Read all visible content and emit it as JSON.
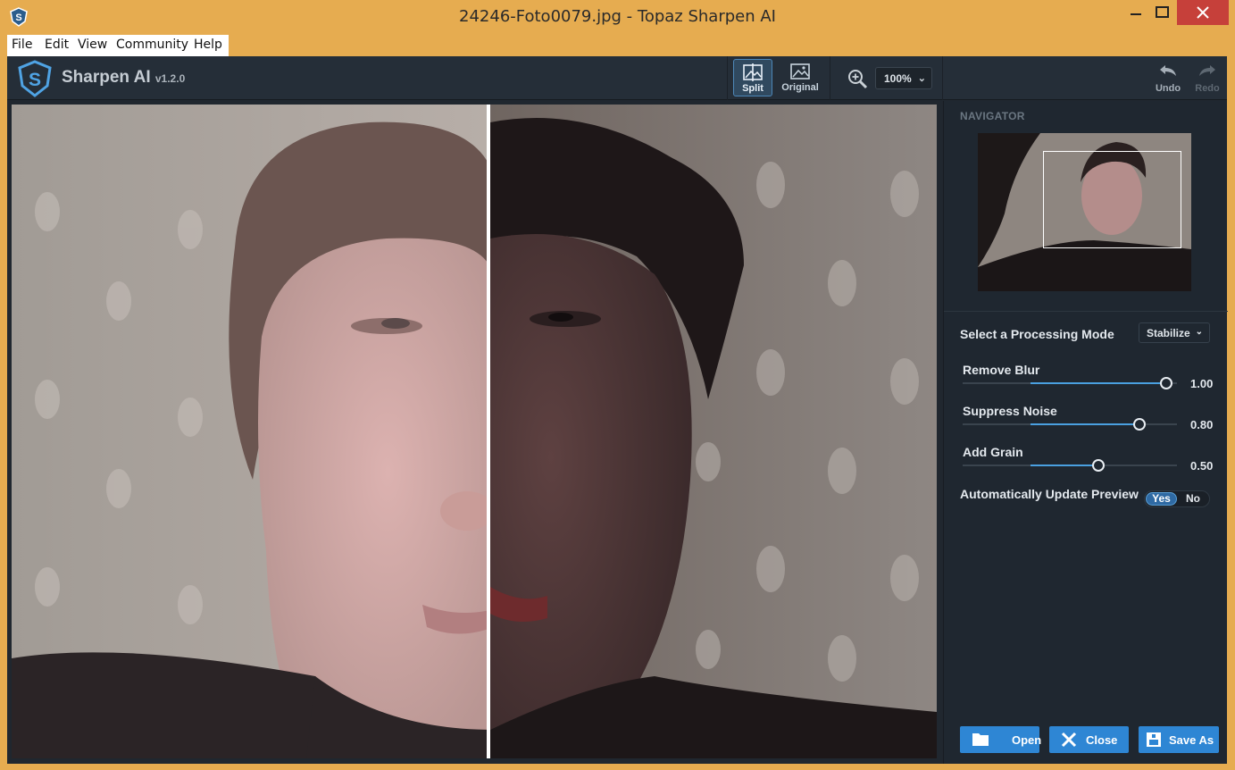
{
  "window": {
    "title": "24246-Foto0079.jpg - Topaz Sharpen AI"
  },
  "menu": {
    "items": [
      "File",
      "Edit",
      "View",
      "Community",
      "Help"
    ]
  },
  "app": {
    "brand": "Sharpen AI",
    "version": "v1.2.0"
  },
  "toolbar": {
    "split_label": "Split",
    "original_label": "Original",
    "zoom_value": "100%",
    "undo_label": "Undo",
    "redo_label": "Redo"
  },
  "navigator": {
    "title": "NAVIGATOR"
  },
  "settings": {
    "mode_label": "Select a Processing Mode",
    "mode_value": "Stabilize",
    "sliders": [
      {
        "label": "Remove Blur",
        "value": 1.0,
        "display": "1.00",
        "min": -0.5,
        "max": 1.0
      },
      {
        "label": "Suppress Noise",
        "value": 0.8,
        "display": "0.80",
        "min": -0.5,
        "max": 1.0
      },
      {
        "label": "Add Grain",
        "value": 0.5,
        "display": "0.50",
        "min": -0.5,
        "max": 1.0
      }
    ],
    "auto_update_label": "Automatically Update Preview",
    "auto_yes": "Yes",
    "auto_no": "No"
  },
  "footer": {
    "open_label": "Open",
    "close_label": "Close",
    "save_as_label": "Save As"
  },
  "colors": {
    "accent": "#2e86d4",
    "panel_bg": "#1f2730",
    "titlebar": "#e6ac50",
    "close_red": "#c6403a"
  }
}
